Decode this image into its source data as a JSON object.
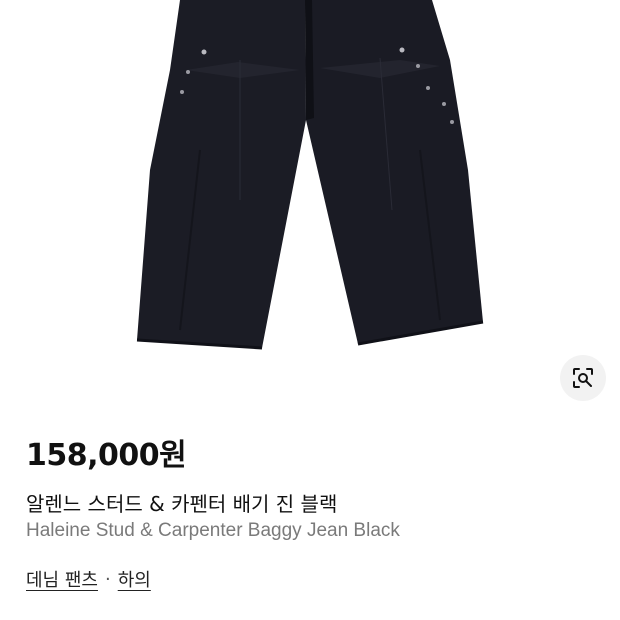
{
  "product": {
    "price": "158,000원",
    "name_ko": "알렌느 스터드 & 카펜터 배기 진 블랙",
    "name_en": "Haleine Stud & Carpenter Baggy Jean Black",
    "image_icon": "black-baggy-jeans-photo"
  },
  "breadcrumb": {
    "category": "데님 팬츠",
    "separator": "·",
    "parent": "하의"
  },
  "actions": {
    "lens_icon": "image-search-lens-icon"
  }
}
